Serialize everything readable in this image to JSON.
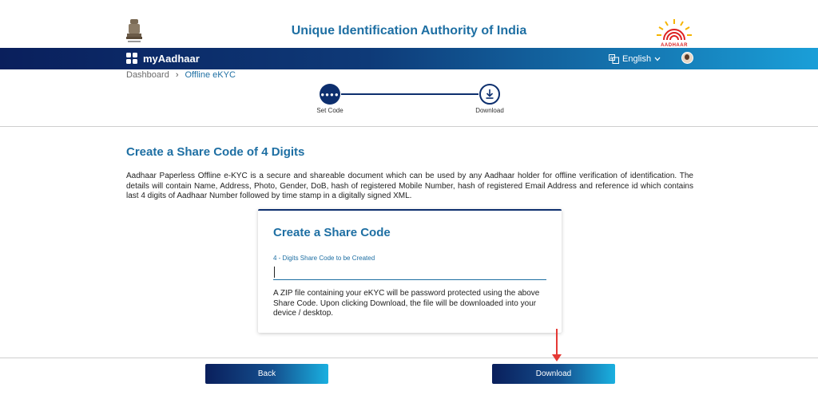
{
  "header": {
    "title": "Unique Identification Authority of India",
    "logo_text": "AADHAAR"
  },
  "nav": {
    "brand": "myAadhaar",
    "language": "English"
  },
  "breadcrumb": {
    "items": [
      "Dashboard",
      "Offline eKYC"
    ]
  },
  "stepper": {
    "steps": [
      {
        "label": "Set Code"
      },
      {
        "label": "Download"
      }
    ],
    "active_step": 1
  },
  "main": {
    "heading": "Create a Share Code of 4 Digits",
    "description": "Aadhaar Paperless Offline e-KYC is a secure and shareable document which can be used by any Aadhaar holder for offline verification of identification. The details will contain Name, Address, Photo, Gender, DoB, hash of registered Mobile Number, hash of registered Email Address and reference id which contains last 4 digits of Aadhaar Number followed by time stamp in a digitally signed XML."
  },
  "card": {
    "title": "Create a Share Code",
    "field_label": "4 - Digits Share Code to be Created",
    "field_value": "",
    "note": "A ZIP file containing your eKYC will be password protected using the above Share Code. Upon clicking Download, the file will be downloaded into your device / desktop."
  },
  "buttons": {
    "back": "Back",
    "download": "Download"
  },
  "colors": {
    "primary": "#0d2f6e",
    "accent": "#1e6fa3",
    "annotation": "#e53935"
  }
}
